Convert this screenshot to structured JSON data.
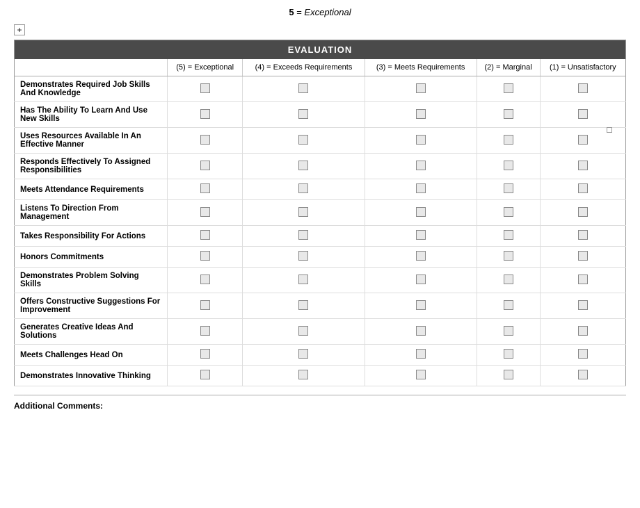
{
  "header": {
    "rating_label": "5",
    "rating_eq": "=",
    "rating_text": "Exceptional"
  },
  "table": {
    "title": "Evaluation",
    "columns": [
      {
        "id": "label",
        "text": ""
      },
      {
        "id": "col5",
        "text": "(5) = Exceptional"
      },
      {
        "id": "col4",
        "text": "(4) = Exceeds Requirements"
      },
      {
        "id": "col3",
        "text": "(3) = Meets Requirements"
      },
      {
        "id": "col2",
        "text": "(2) = Marginal"
      },
      {
        "id": "col1",
        "text": "(1) = Unsatisfactory"
      }
    ],
    "rows": [
      {
        "id": "row1",
        "label": "Demonstrates Required Job Skills And Knowledge"
      },
      {
        "id": "row2",
        "label": "Has The Ability To Learn And Use New Skills"
      },
      {
        "id": "row3",
        "label": "Uses Resources Available In An Effective Manner"
      },
      {
        "id": "row4",
        "label": "Responds Effectively To Assigned Responsibilities"
      },
      {
        "id": "row5",
        "label": "Meets Attendance Requirements"
      },
      {
        "id": "row6",
        "label": "Listens To Direction From Management"
      },
      {
        "id": "row7",
        "label": "Takes Responsibility For Actions"
      },
      {
        "id": "row8",
        "label": "Honors Commitments"
      },
      {
        "id": "row9",
        "label": "Demonstrates Problem Solving Skills"
      },
      {
        "id": "row10",
        "label": "Offers Constructive Suggestions For Improvement"
      },
      {
        "id": "row11",
        "label": "Generates Creative Ideas And Solutions"
      },
      {
        "id": "row12",
        "label": "Meets Challenges Head On"
      },
      {
        "id": "row13",
        "label": "Demonstrates Innovative Thinking"
      }
    ]
  },
  "additional_comments_label": "Additional Comments:"
}
